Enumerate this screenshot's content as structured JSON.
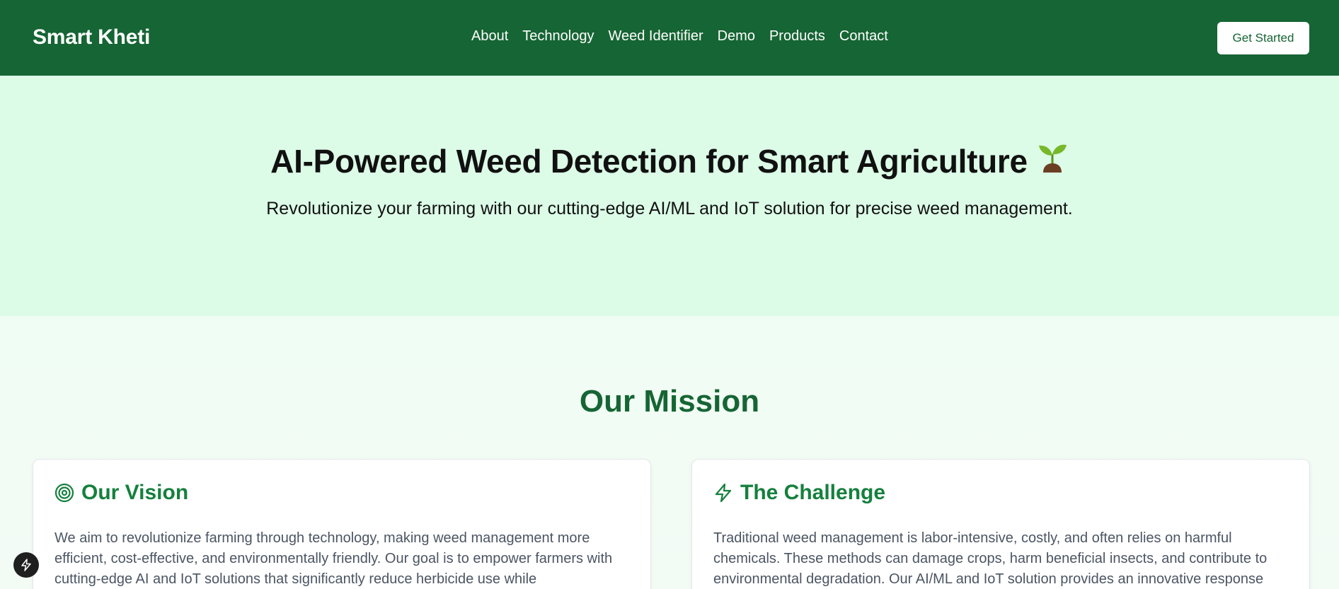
{
  "header": {
    "brand": "Smart Kheti",
    "nav": [
      "About",
      "Technology",
      "Weed Identifier",
      "Demo",
      "Products",
      "Contact"
    ],
    "cta_label": "Get Started"
  },
  "hero": {
    "title": "AI-Powered Weed Detection for Smart Agriculture",
    "title_icon": "sprout-icon",
    "subtitle": "Revolutionize your farming with our cutting-edge AI/ML and IoT solution for precise weed management."
  },
  "mission": {
    "title": "Our Mission",
    "cards": [
      {
        "icon": "target-icon",
        "title": "Our Vision",
        "body": "We aim to revolutionize farming through technology, making weed management more efficient, cost-effective, and environmentally friendly. Our goal is to empower farmers with cutting-edge AI and IoT solutions that significantly reduce herbicide use while"
      },
      {
        "icon": "lightning-icon",
        "title": "The Challenge",
        "body": "Traditional weed management is labor-intensive, costly, and often relies on harmful chemicals. These methods can damage crops, harm beneficial insects, and contribute to environmental degradation. Our AI/ML and IoT solution provides an innovative response"
      }
    ]
  },
  "colors": {
    "header_bg": "#166534",
    "hero_bg": "#dcfce7",
    "accent": "#15803d"
  }
}
